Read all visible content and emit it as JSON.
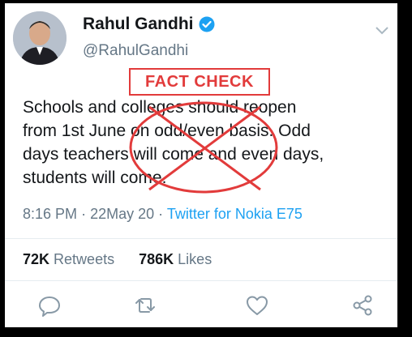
{
  "tweet": {
    "author": {
      "name": "Rahul Gandhi",
      "handle": "@RahulGandhi",
      "verified": true,
      "avatar_icon": "profile-photo"
    },
    "overlay_label": "FACT CHECK",
    "text_lines": [
      "Schools and colleges should reopen",
      "from 1st June on odd/even basis. Odd",
      "days teachers will come and even days,",
      "students will come."
    ],
    "time": "8:16 PM",
    "date": "22May 20",
    "separator": "·",
    "source": "Twitter for Nokia E75",
    "retweets_count": "72K",
    "retweets_label": "Retweets",
    "likes_count": "786K",
    "likes_label": "Likes",
    "actions": [
      "reply-icon",
      "retweet-icon",
      "like-icon",
      "share-icon"
    ]
  },
  "colors": {
    "verified": "#1da1f2",
    "fact_check": "#e23b3b",
    "link": "#1da1f2",
    "secondary_text": "#657786"
  }
}
